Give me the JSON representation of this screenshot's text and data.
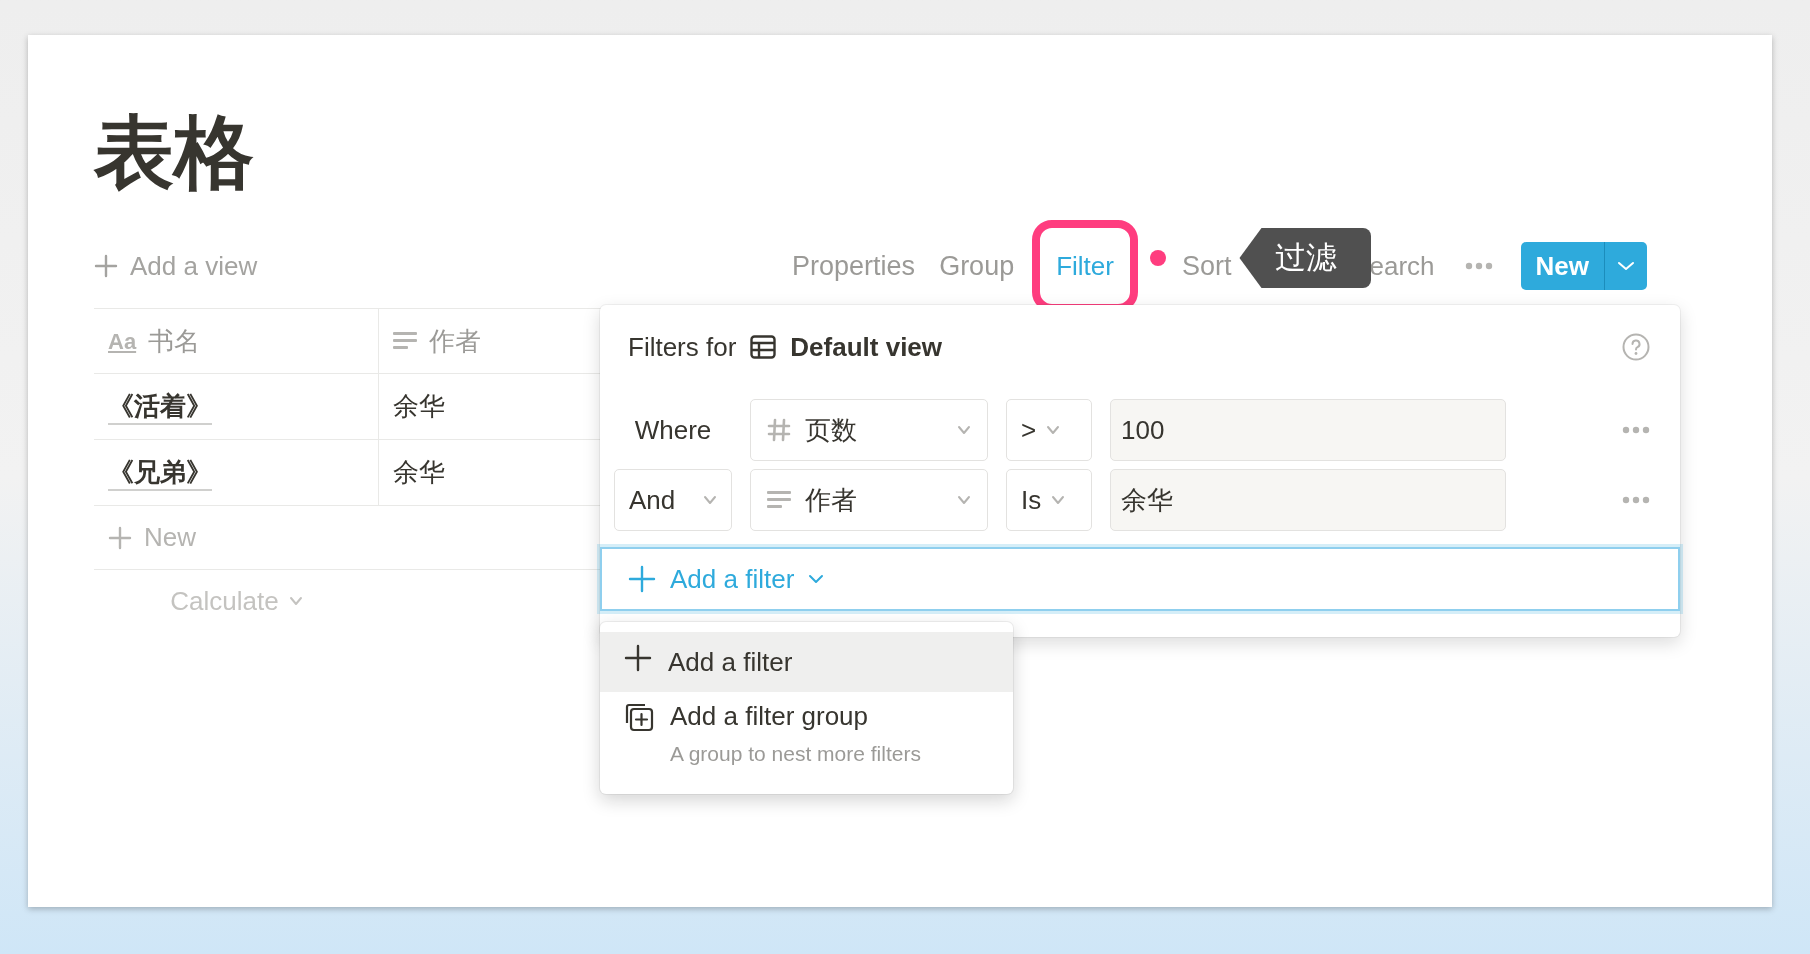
{
  "page": {
    "title": "表格"
  },
  "toolbar": {
    "add_view": "Add a view",
    "items": [
      {
        "label": "Properties",
        "selected": false
      },
      {
        "label": "Group",
        "selected": false
      },
      {
        "label": "Filter",
        "selected": true
      },
      {
        "label": "Sort",
        "selected": false
      }
    ],
    "search_partial": "earch",
    "new_button": "New"
  },
  "annotation": {
    "tooltip": "过滤"
  },
  "table": {
    "columns": [
      {
        "name": "书名",
        "kind": "title",
        "icon_text": "Aa"
      },
      {
        "name": "作者",
        "kind": "text"
      }
    ],
    "rows": [
      [
        "《活着》",
        "余华"
      ],
      [
        "《兄弟》",
        "余华"
      ]
    ],
    "new_row": "New",
    "calculate": "Calculate"
  },
  "filter_panel": {
    "title": "Filters for",
    "view": "Default view",
    "rules": [
      {
        "conjunction": {
          "label": "Where",
          "kind": "label"
        },
        "property": {
          "name": "页数",
          "kind": "number"
        },
        "operator": ">",
        "value": "100"
      },
      {
        "conjunction": {
          "label": "And",
          "kind": "select"
        },
        "property": {
          "name": "作者",
          "kind": "text"
        },
        "operator": "Is",
        "value": "余华"
      }
    ],
    "add_filter": "Add a filter"
  },
  "menu": {
    "items": [
      {
        "label": "Add a filter",
        "kind": "filter",
        "selected": true
      },
      {
        "label": "Add a filter group",
        "description": "A group to nest more filters",
        "kind": "group",
        "selected": false
      }
    ]
  }
}
